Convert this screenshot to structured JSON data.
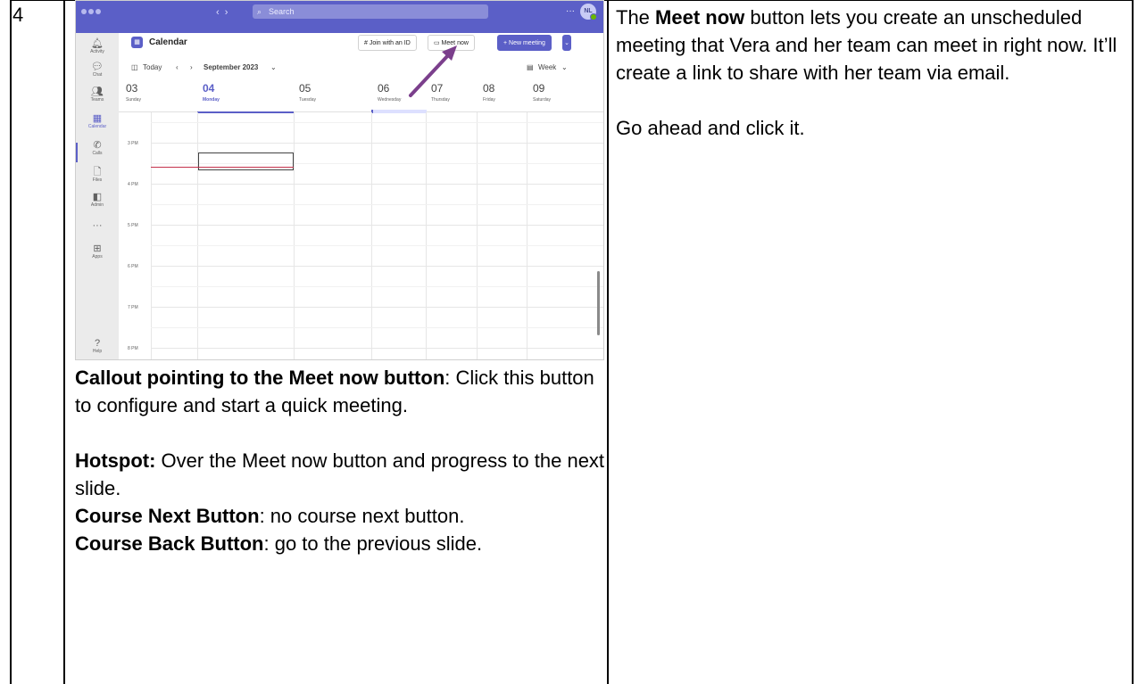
{
  "step_number": "4",
  "right": {
    "p1_bold": "Meet now",
    "p1_rest": " button lets you create an unscheduled meeting that Vera and her team can meet in right now. It’ll create a link to share with her team via email.",
    "p1_pre": "The ",
    "p2": "Go ahead and click it."
  },
  "left": {
    "callout_bold": "Callout pointing to the Meet now button",
    "callout_rest": ": Click this button to configure and start a quick meeting.",
    "hotspot_bold": "Hotspot:",
    "hotspot_rest": " Over the Meet now button and progress to the next slide.",
    "next_bold": "Course Next Button",
    "next_rest": ": no course next button.",
    "back_bold": "Course Back Button",
    "back_rest": ": go to the previous slide."
  },
  "teams": {
    "search_placeholder": "Search",
    "avatar_initials": "NL",
    "rail": [
      {
        "icon": "bell-icon",
        "glyph": "🔔︎",
        "label": "Activity"
      },
      {
        "icon": "chat-icon",
        "glyph": "💬︎",
        "label": "Chat"
      },
      {
        "icon": "teams-icon",
        "glyph": "👥︎",
        "label": "Teams"
      },
      {
        "icon": "calendar-icon",
        "glyph": "▦",
        "label": "Calendar"
      },
      {
        "icon": "phone-icon",
        "glyph": "✆",
        "label": "Calls"
      },
      {
        "icon": "file-icon",
        "glyph": "🗋︎",
        "label": "Files"
      },
      {
        "icon": "admin-icon",
        "glyph": "◧",
        "label": "Admin"
      },
      {
        "icon": "more-icon",
        "glyph": "···",
        "label": ""
      },
      {
        "icon": "apps-icon",
        "glyph": "⊞",
        "label": "Apps"
      },
      {
        "icon": "help-icon",
        "glyph": "?",
        "label": "Help"
      }
    ],
    "header": {
      "title": "Calendar",
      "join_label": "# Join with an ID",
      "meet_now_label": "▭ Meet now",
      "new_meeting_label": "+ New meeting"
    },
    "nav": {
      "today_label": "Today",
      "month_label": "September 2023",
      "view_label": "Week"
    },
    "days": [
      {
        "num": "03",
        "name": "Sunday"
      },
      {
        "num": "04",
        "name": "Monday"
      },
      {
        "num": "05",
        "name": "Tuesday"
      },
      {
        "num": "06",
        "name": "Wednesday"
      },
      {
        "num": "07",
        "name": "Thursday"
      },
      {
        "num": "08",
        "name": "Friday"
      },
      {
        "num": "09",
        "name": "Saturday"
      }
    ],
    "times": [
      "3 PM",
      "4 PM",
      "5 PM",
      "6 PM",
      "7 PM",
      "8 PM"
    ],
    "accent_color": "#5b5fc7",
    "arrow_color": "#7b3f8c"
  }
}
